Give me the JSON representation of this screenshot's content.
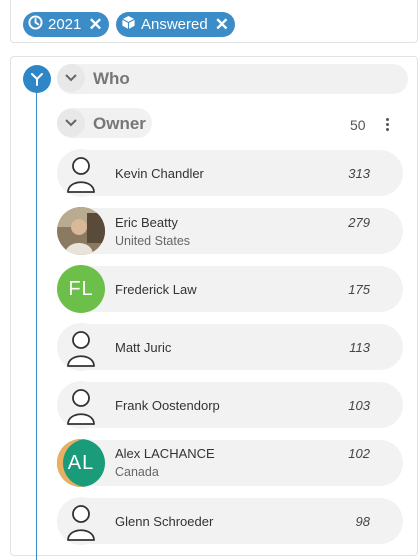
{
  "filters": [
    {
      "icon": "clock-icon",
      "label": "2021"
    },
    {
      "icon": "cube-icon",
      "label": "Answered"
    }
  ],
  "who_section": {
    "label": "Who"
  },
  "owner_section": {
    "label": "Owner",
    "count": "50"
  },
  "colors": {
    "accent": "#3b8cc7",
    "row_bg": "#f2f2f2",
    "green_avatar": "#6cc04a",
    "teal_avatar": "#1a9b7a"
  },
  "owners": [
    {
      "name": "Kevin Chandler",
      "sub": "",
      "count": "313",
      "avatar": "placeholder-avatar"
    },
    {
      "name": "Eric Beatty",
      "sub": "United States",
      "count": "279",
      "avatar": "photo-avatar"
    },
    {
      "name": "Frederick Law",
      "sub": "",
      "count": "175",
      "avatar": "FL"
    },
    {
      "name": "Matt Juric",
      "sub": "",
      "count": "113",
      "avatar": "placeholder-avatar"
    },
    {
      "name": "Frank Oostendorp",
      "sub": "",
      "count": "103",
      "avatar": "placeholder-avatar"
    },
    {
      "name": "Alex LACHANCE",
      "sub": "Canada",
      "count": "102",
      "avatar": "AL"
    },
    {
      "name": "Glenn Schroeder",
      "sub": "",
      "count": "98",
      "avatar": "placeholder-avatar"
    }
  ]
}
